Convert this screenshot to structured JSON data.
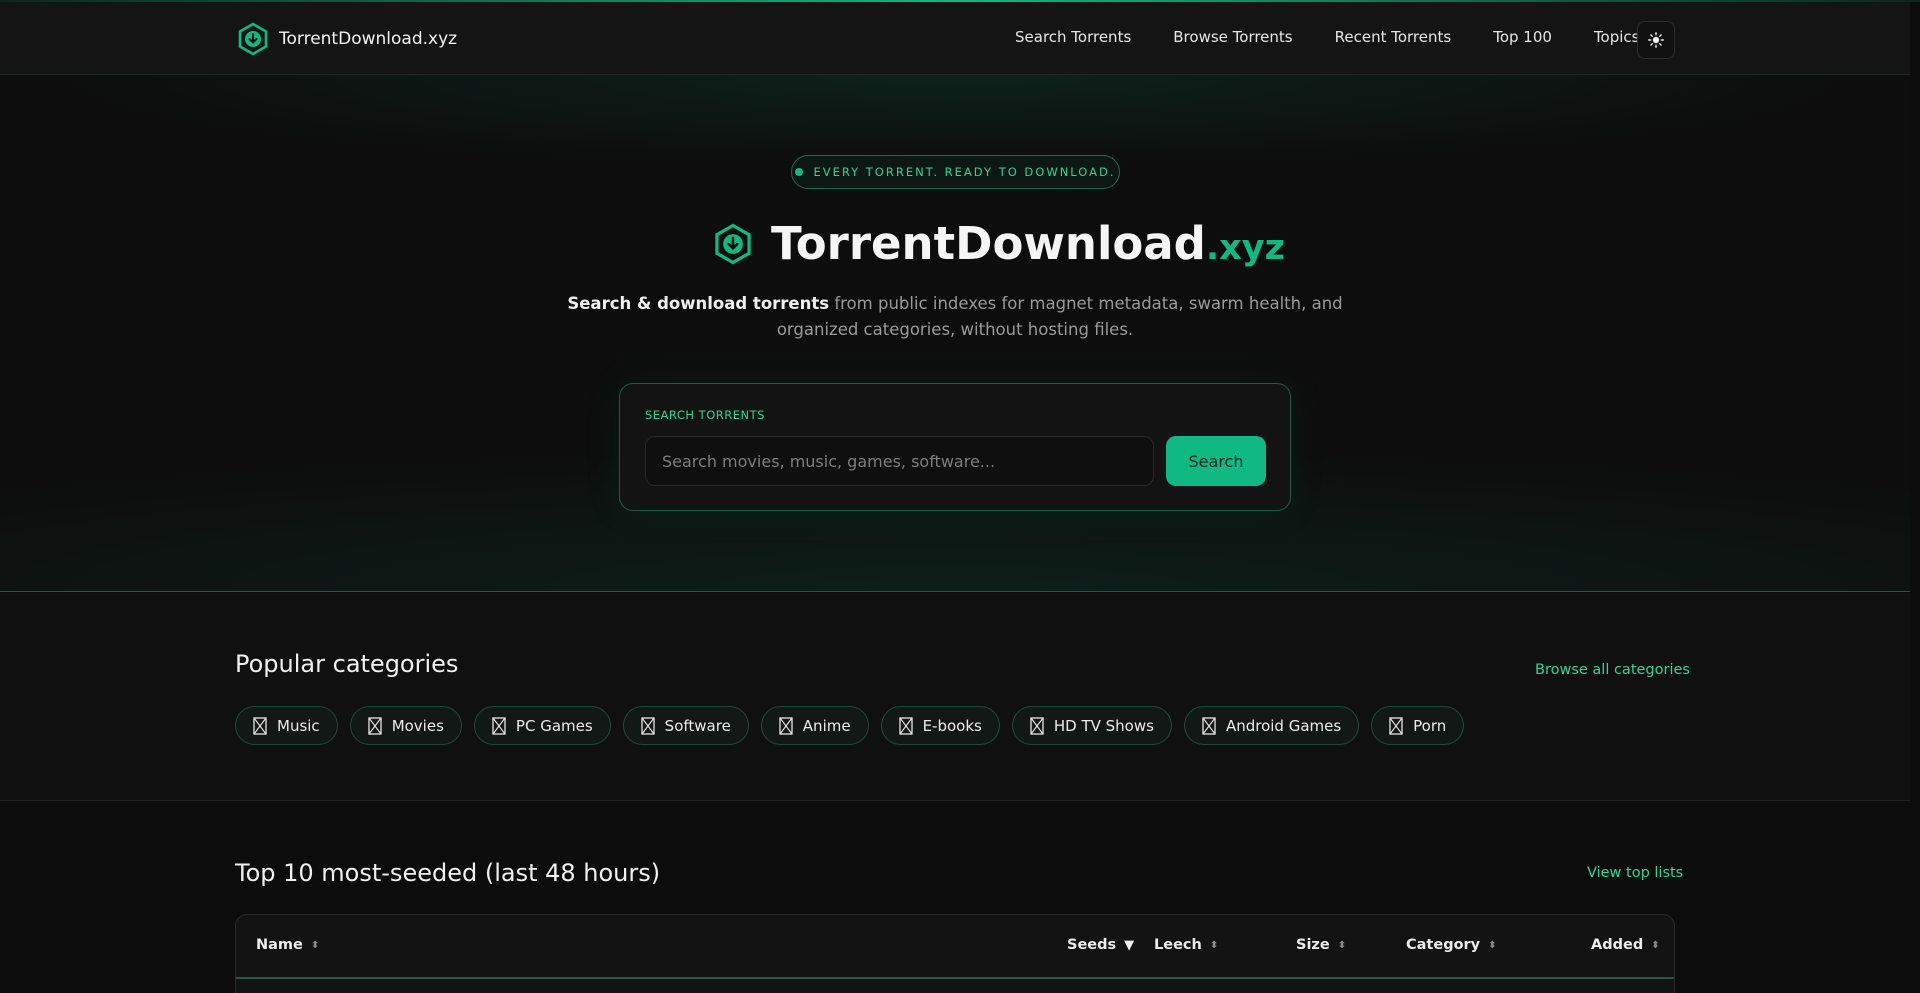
{
  "header": {
    "brand": "TorrentDownload.xyz",
    "nav": [
      "Search Torrents",
      "Browse Torrents",
      "Recent Torrents",
      "Top 100",
      "Topics"
    ],
    "theme_icon": "sun-icon"
  },
  "hero": {
    "tagline": "EVERY TORRENT. READY TO DOWNLOAD.",
    "title_main": "TorrentDownload",
    "title_tld": ".xyz",
    "desc_bold": "Search & download torrents",
    "desc_rest": " from public indexes for magnet metadata, swarm health, and organized categories, without hosting files.",
    "search": {
      "label": "SEARCH TORRENTS",
      "placeholder": "Search movies, music, games, software...",
      "value": "",
      "button": "Search"
    }
  },
  "categories": {
    "title": "Popular categories",
    "link": "Browse all categories",
    "items": [
      "Music",
      "Movies",
      "PC Games",
      "Software",
      "Anime",
      "E-books",
      "HD TV Shows",
      "Android Games",
      "Porn"
    ]
  },
  "top10": {
    "title": "Top 10 most-seeded (last 48 hours)",
    "link": "View top lists",
    "columns": [
      "Name",
      "Seeds",
      "Leech",
      "Size",
      "Category",
      "Added"
    ],
    "sorted_column": "Seeds",
    "sort_direction": "desc"
  },
  "colors": {
    "accent": "#10b981",
    "background": "#0c0c0c"
  }
}
